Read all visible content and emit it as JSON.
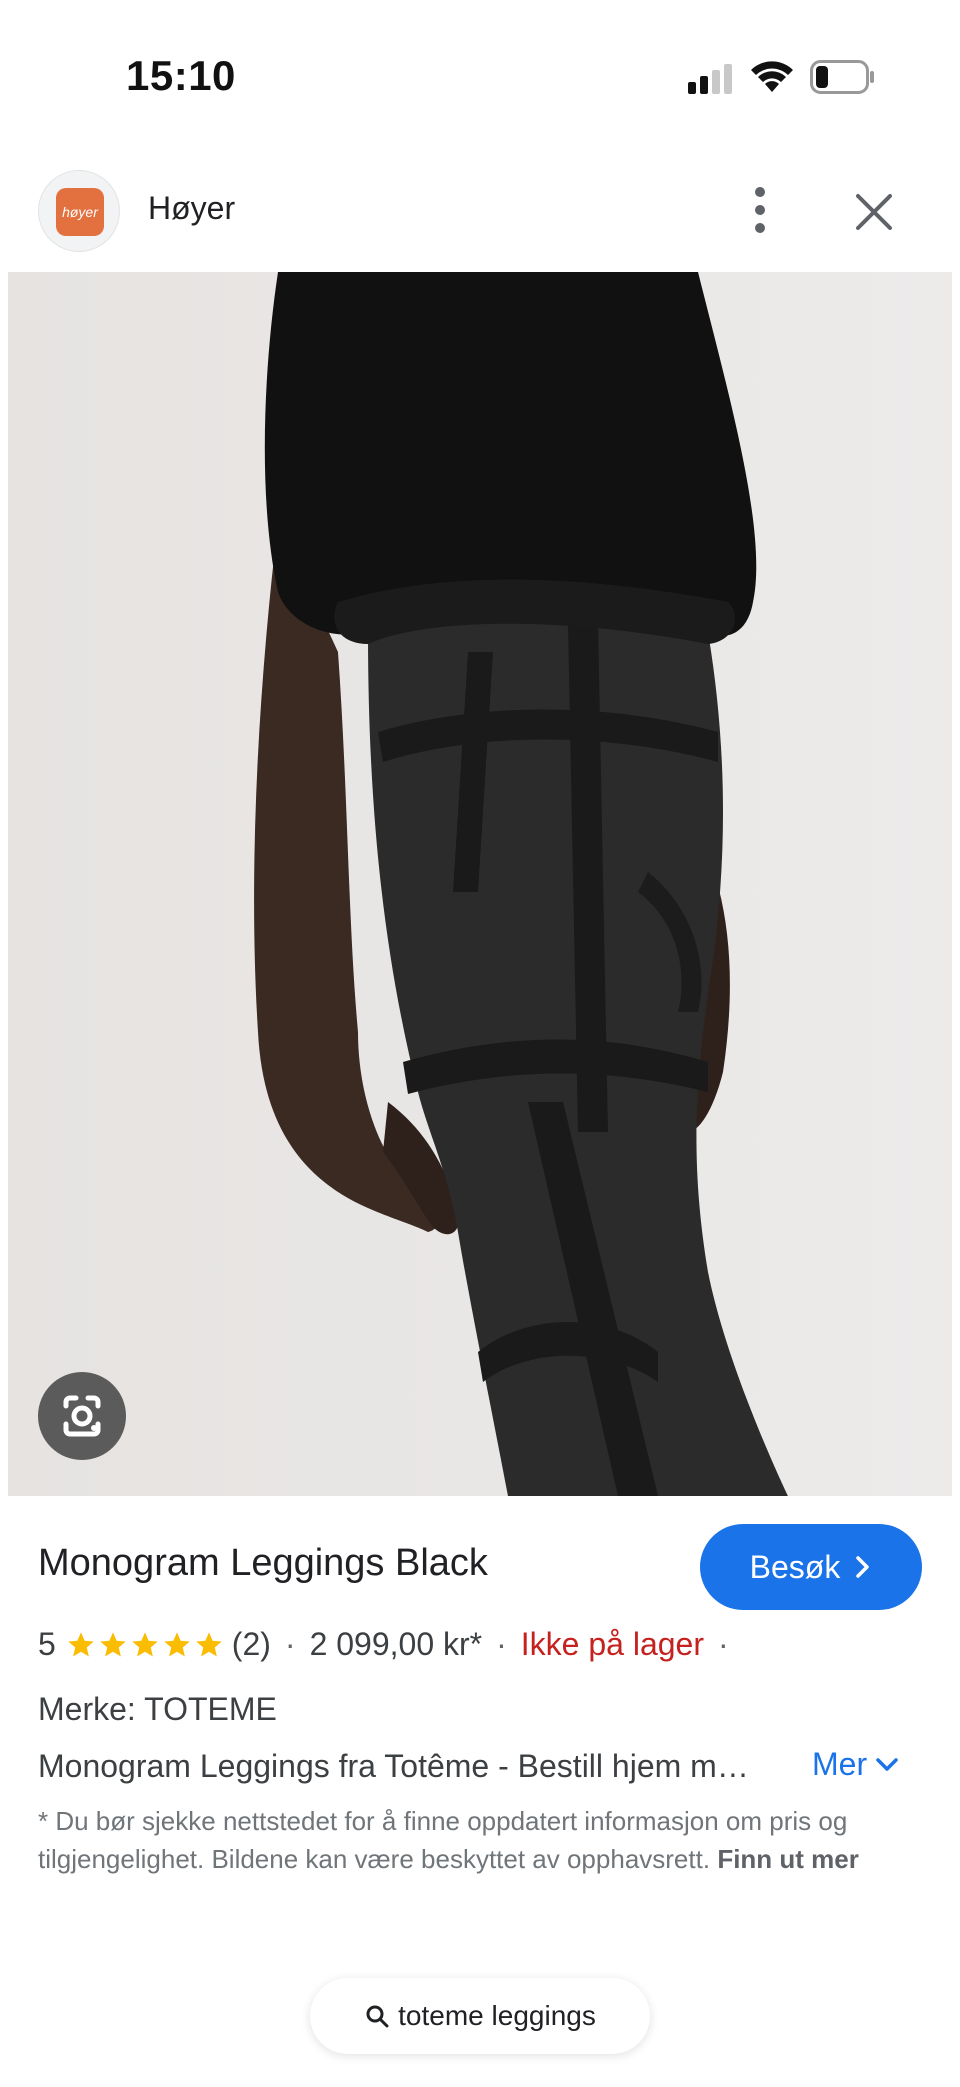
{
  "status_bar": {
    "time": "15:10"
  },
  "header": {
    "logo_text": "høyer",
    "site_name": "Høyer",
    "more_icon": "more-vert-icon",
    "close_icon": "close-icon"
  },
  "image": {
    "lens_icon": "google-lens-icon"
  },
  "product": {
    "title": "Monogram Leggings Black",
    "visit_label": "Besøk",
    "rating": "5",
    "rating_stars": 5,
    "review_count": "(2)",
    "separator": "·",
    "price": "2 099,00 kr*",
    "availability": "Ikke på lager",
    "brand": "Merke: TOTEME",
    "description": "Monogram Leggings fra Totême - Bestill hjem m…",
    "more_label": "Mer",
    "disclaimer_text": "* Du bør sjekke nettstedet for å finne oppdatert informasjon om pris og tilgjengelighet. Bildene kan være beskyttet av opphavsrett.",
    "disclaimer_link": "Finn ut mer"
  },
  "search": {
    "query": "toteme leggings"
  },
  "colors": {
    "accent": "#1a73e8",
    "star": "#fbbc04",
    "out_of_stock": "#c5221f",
    "logo_bg": "#e3703f"
  }
}
